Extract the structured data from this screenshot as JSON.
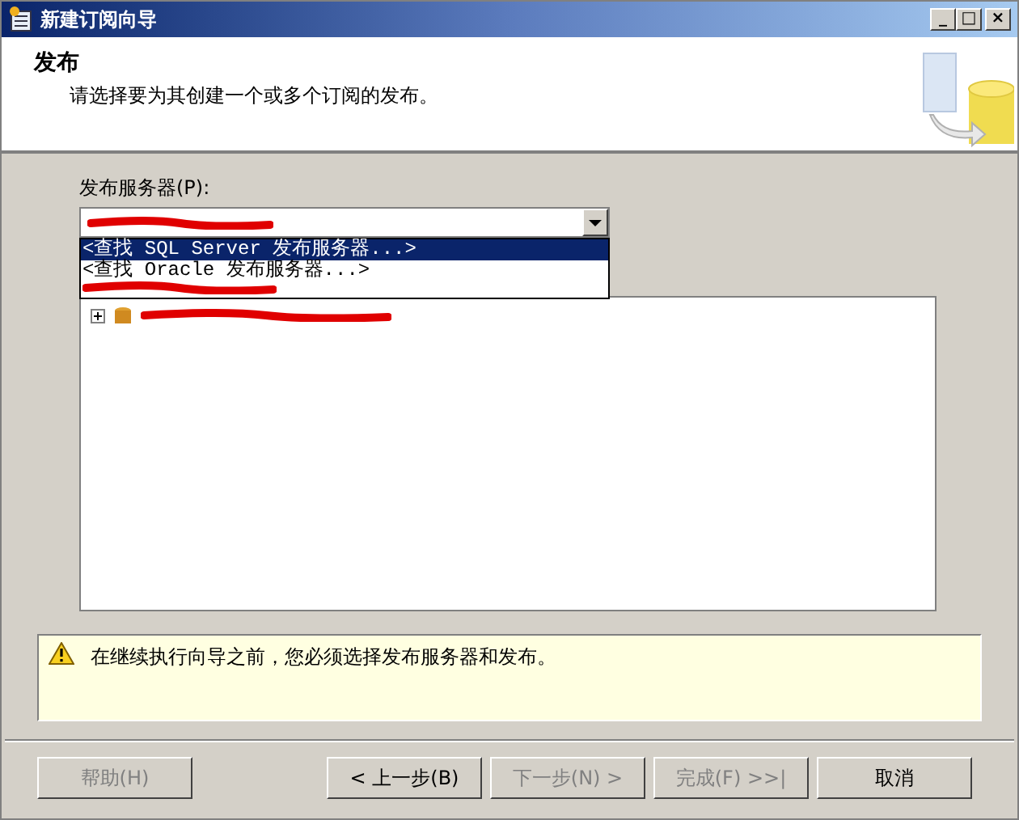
{
  "window": {
    "title": "新建订阅向导",
    "controls": [
      "_",
      "□",
      "×"
    ]
  },
  "header": {
    "title": "发布",
    "subtitle": "请选择要为其创建一个或多个订阅的发布。"
  },
  "publisher": {
    "label": "发布服务器(P):",
    "expanded": true,
    "options": [
      {
        "label": "<查找 SQL Server 发布服务器...>",
        "selected": true
      },
      {
        "label": "<查找 Oracle 发布服务器...>",
        "selected": false
      }
    ]
  },
  "tree": {
    "items": [
      {
        "expanded": false
      }
    ]
  },
  "warning": {
    "text": "在继续执行向导之前，您必须选择发布服务器和发布。"
  },
  "buttons": [
    {
      "label": "帮助(H)",
      "disabled": true
    },
    {
      "label": "< 上一步(B)",
      "disabled": false
    },
    {
      "label": "下一步(N) >",
      "disabled": true
    },
    {
      "label": "完成(F) >>|",
      "disabled": true
    },
    {
      "label": "取消",
      "disabled": false
    }
  ]
}
